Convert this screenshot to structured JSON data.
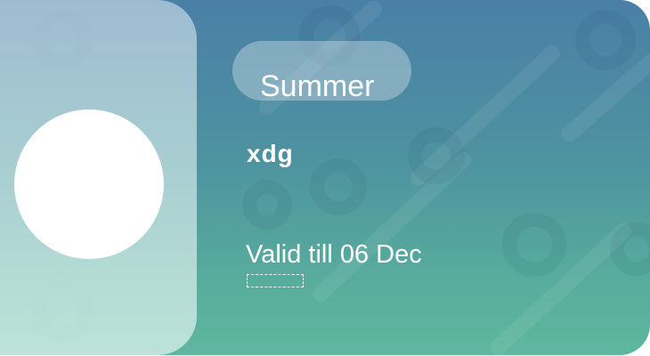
{
  "card": {
    "pill_label": "Summer",
    "name": "xdg",
    "validity": "Valid till 06 Dec",
    "colors": {
      "gradient_top": "#4a7fa6",
      "gradient_bottom": "#5fb79e",
      "text": "#ffffff"
    }
  }
}
